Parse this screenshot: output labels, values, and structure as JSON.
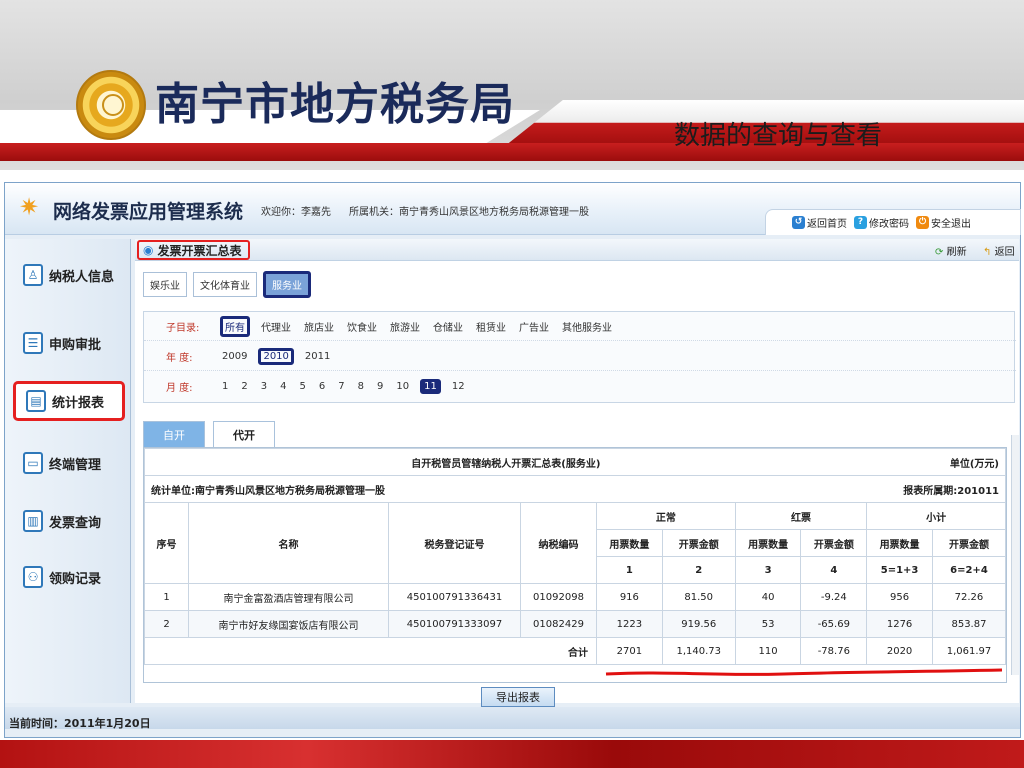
{
  "slide": {
    "bureau": "南宁市地方税务局",
    "subtitle": "数据的查询与查看"
  },
  "app": {
    "name": "网络发票应用管理系统",
    "welcome": "欢迎你：李嘉先",
    "org": "所属机关：南宁青秀山风景区地方税务局税源管理一股",
    "tools": {
      "home": "返回首页",
      "password": "修改密码",
      "logout": "安全退出"
    }
  },
  "sidebar": {
    "items": [
      {
        "label": "纳税人信息",
        "icon": "person-icon"
      },
      {
        "label": "申购审批",
        "icon": "approve-icon"
      },
      {
        "label": "统计报表",
        "icon": "report-icon"
      },
      {
        "label": "终端管理",
        "icon": "terminal-icon"
      },
      {
        "label": "发票查询",
        "icon": "chart-icon"
      },
      {
        "label": "领购记录",
        "icon": "record-icon"
      }
    ]
  },
  "status": "当前时间：2011年1月20日",
  "main": {
    "title": "发票开票汇总表",
    "refresh": "刷新",
    "back": "返回",
    "type_tabs": [
      "娱乐业",
      "文化体育业",
      "服务业"
    ],
    "filters": {
      "catalog_label": "子目录:",
      "catalog": [
        "所有",
        "代理业",
        "旅店业",
        "饮食业",
        "旅游业",
        "仓储业",
        "租赁业",
        "广告业",
        "其他服务业"
      ],
      "year_label": "年  度:",
      "years": [
        "2009",
        "2010",
        "2011"
      ],
      "month_label": "月  度:",
      "months": [
        "1",
        "2",
        "3",
        "4",
        "5",
        "6",
        "7",
        "8",
        "9",
        "10",
        "11",
        "12"
      ]
    },
    "issue_tabs": {
      "self": "自开",
      "proxy": "代开"
    },
    "report": {
      "title": "自开税管员管辖纳税人开票汇总表(服务业)",
      "unit": "单位(万元)",
      "org": "统计单位:南宁青秀山风景区地方税务局税源管理一股",
      "period": "报表所属期:201011",
      "headers": {
        "seq": "序号",
        "name": "名称",
        "reg": "税务登记证号",
        "code": "纳税编码",
        "normal": "正常",
        "red": "红票",
        "subtotal": "小计",
        "qty": "用票数量",
        "amt": "开票金额",
        "c1": "1",
        "c2": "2",
        "c3": "3",
        "c4": "4",
        "c5": "5=1+3",
        "c6": "6=2+4"
      },
      "rows": [
        {
          "seq": "1",
          "name": "南宁金富盈酒店管理有限公司",
          "reg": "450100791336431",
          "code": "01092098",
          "q1": "916",
          "a1": "81.50",
          "q2": "40",
          "a2": "-9.24",
          "q3": "956",
          "a3": "72.26"
        },
        {
          "seq": "2",
          "name": "南宁市好友缘国宴饭店有限公司",
          "reg": "450100791333097",
          "code": "01082429",
          "q1": "1223",
          "a1": "919.56",
          "q2": "53",
          "a2": "-65.69",
          "q3": "1276",
          "a3": "853.87"
        }
      ],
      "total_label": "合计",
      "totals": {
        "q1": "2701",
        "a1": "1,140.73",
        "q2": "110",
        "a2": "-78.76",
        "q3": "2020",
        "a3": "1,061.97"
      }
    },
    "export": "导出报表"
  }
}
